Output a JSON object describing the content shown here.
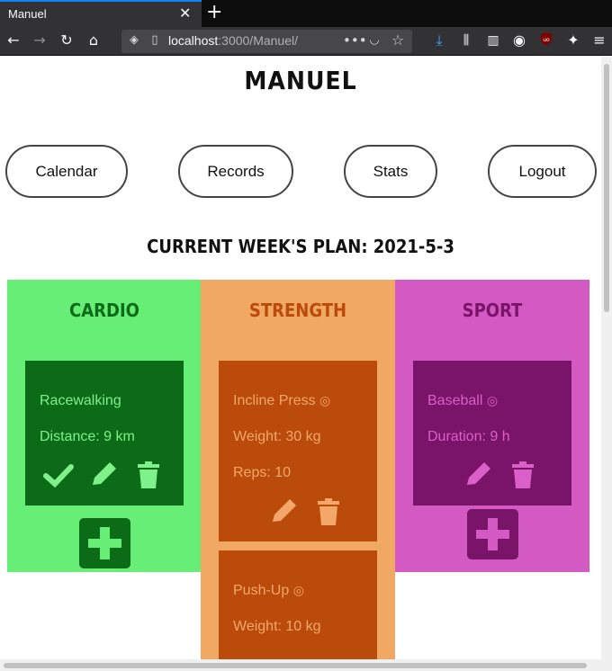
{
  "browser": {
    "tab_title": "Manuel",
    "url_host": "localhost",
    "url_path": ":3000/Manuel/",
    "icons": [
      "back-icon",
      "forward-icon",
      "reload-icon",
      "home-icon",
      "shield-icon",
      "page-icon",
      "more-icon",
      "pocket-icon",
      "star-icon",
      "download-icon",
      "library-icon",
      "sidebar-icon",
      "account-icon",
      "ublock-icon",
      "extension-icon",
      "menu-icon"
    ]
  },
  "page": {
    "title": "MANUEL",
    "nav": {
      "calendar": "Calendar",
      "records": "Records",
      "stats": "Stats",
      "logout": "Logout"
    },
    "week_plan": "CURRENT WEEK'S PLAN: 2021-5-3"
  },
  "columns": {
    "cardio": {
      "heading": "CARDIO",
      "bg": "#66ee77",
      "card_bg": "#0b6b17",
      "text_color": "#7ff08a",
      "cards": [
        {
          "name": "Racewalking",
          "line2": "Distance: 9 km",
          "completed": false
        }
      ]
    },
    "strength": {
      "heading": "STRENGTH",
      "bg": "#f0a862",
      "card_bg": "#bb4b0a",
      "text_color": "#f3a769",
      "cards": [
        {
          "name": "Incline Press",
          "line2": "Weight: 30 kg",
          "line3": "Reps: 10",
          "completed": true
        },
        {
          "name": "Push-Up",
          "line2": "Weight: 10 kg",
          "completed": true
        }
      ]
    },
    "sport": {
      "heading": "SPORT",
      "bg": "#d35ac2",
      "card_bg": "#7a1469",
      "text_color": "#da5fc9",
      "cards": [
        {
          "name": "Baseball",
          "line2": "Duration: 9 h",
          "completed": true
        }
      ]
    }
  }
}
